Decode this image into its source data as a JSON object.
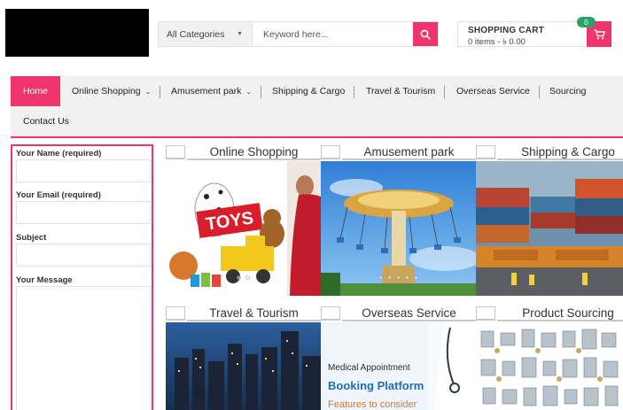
{
  "search": {
    "category_label": "All Categories",
    "placeholder": "Keyword here..."
  },
  "cart": {
    "title": "SHOPPING CART",
    "summary": "0 items - ৳ 0.00",
    "count": "0"
  },
  "nav": {
    "items": [
      {
        "label": "Home",
        "active": true
      },
      {
        "label": "Online Shopping",
        "dropdown": true
      },
      {
        "label": "Amusement park",
        "dropdown": true
      },
      {
        "label": "Shipping & Cargo"
      },
      {
        "label": "Travel & Tourism"
      },
      {
        "label": "Overseas Service"
      },
      {
        "label": "Sourcing"
      },
      {
        "label": "Contact Us"
      }
    ]
  },
  "form": {
    "name_label": "Your Name (required)",
    "email_label": "Your Email (required)",
    "subject_label": "Subject",
    "message_label": "Your Message"
  },
  "tiles": [
    {
      "title": "Online Shopping",
      "image": "toys-and-fashion-photo",
      "badge": "TOYS"
    },
    {
      "title": "Amusement park",
      "image": "swing-ride-photo"
    },
    {
      "title": "Shipping & Cargo",
      "image": "cargo-port-photo"
    },
    {
      "title": "Travel & Tourism",
      "image": "city-skyline-night-photo"
    },
    {
      "title": "Overseas Service",
      "image": "medical-booking-banner",
      "banner_line1": "Medical Appointment",
      "banner_line2": "Booking Platform",
      "banner_line3": "Features to consider"
    },
    {
      "title": "Product Sourcing",
      "image": "machinery-catalog-photo"
    }
  ],
  "colors": {
    "accent": "#f0356d",
    "badge_green": "#27a36a",
    "nav_bg": "#f1f1f1"
  }
}
